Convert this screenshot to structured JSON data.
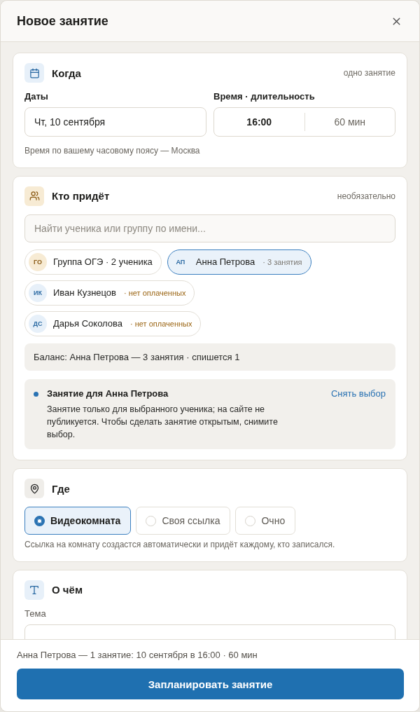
{
  "dialog": {
    "title": "Новое занятие"
  },
  "when": {
    "title": "Когда",
    "hint": "одно занятие",
    "dates_label": "Даты",
    "date_value": "Чт, 10 сентября",
    "time_label": "Время · длительность",
    "time_value": "16:00",
    "duration_value": "60 мин",
    "note": "Время по вашему часовому поясу — Москва"
  },
  "who": {
    "title": "Кто придёт",
    "hint": "необязательно",
    "search": {
      "placeholder": "Найти ученика или группу по имени..."
    },
    "chips": [
      {
        "kind": "group",
        "initials": "ГО",
        "name": "Группа ОГЭ · 2 ученика",
        "selected": false
      },
      {
        "kind": "student",
        "initials": "АП",
        "name": "Анна Петрова",
        "note": {
          "text": "· 3 занятия",
          "kind": "balance"
        },
        "selected": true
      },
      {
        "kind": "student",
        "initials": "ИК",
        "name": "Иван Кузнецов",
        "note": {
          "text": "· нет оплаченных",
          "kind": "unpaid"
        },
        "selected": false
      },
      {
        "kind": "student",
        "initials": "ДС",
        "name": "Дарья Соколова",
        "note": {
          "text": "· нет оплаченных",
          "kind": "unpaid"
        },
        "selected": false
      }
    ],
    "balance": "Баланс: Анна Петрова — 3 занятия · спишется 1",
    "notice": {
      "title": "Занятие для Анна Петрова",
      "text": "Занятие только для выбранного ученика; на сайте не публикуется. Чтобы сделать занятие открытым, снимите выбор.",
      "action": "Снять выбор"
    }
  },
  "where": {
    "title": "Где",
    "options": [
      {
        "label": "Видеокомната",
        "selected": true
      },
      {
        "label": "Своя ссылка",
        "selected": false
      },
      {
        "label": "Очно",
        "selected": false
      }
    ],
    "note": "Ссылка на комнату создастся автоматически и придёт каждому, кто записался."
  },
  "topic": {
    "title": "О чём",
    "label": "Тема"
  },
  "footer": {
    "summary": "Анна Петрова — 1 занятие: 10 сентября в 16:00 · 60 мин",
    "submit": "Запланировать занятие"
  }
}
